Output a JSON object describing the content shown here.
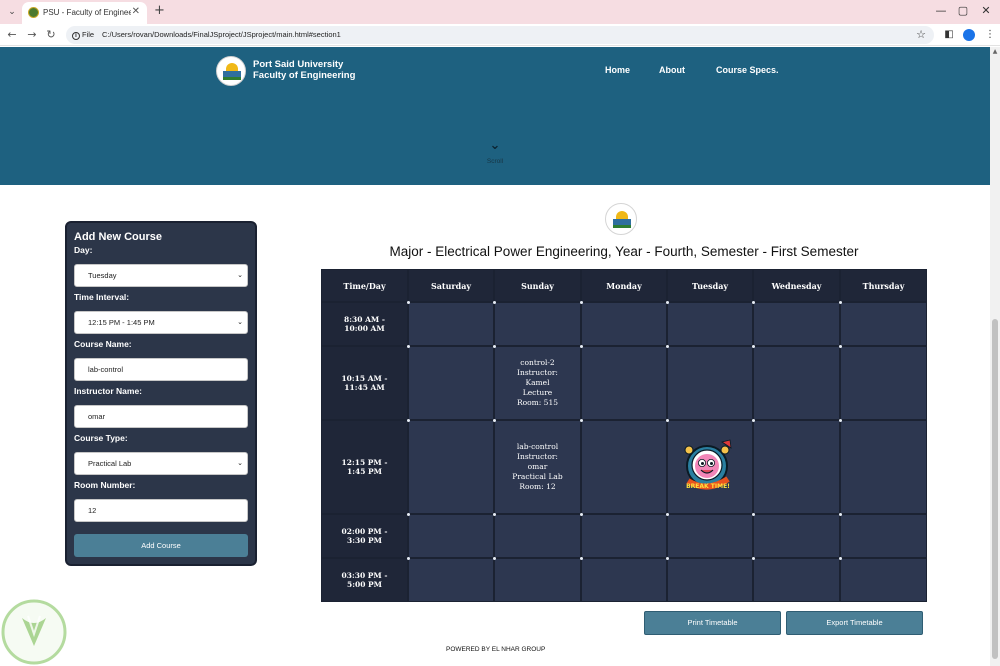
{
  "browser": {
    "tab_title": "PSU - Faculty of Engineering Ti",
    "tab_list_icon": "chevron-down",
    "close_glyph": "✕",
    "newtab_glyph": "+",
    "minimize_glyph": "—",
    "maximize_glyph": "▢",
    "window_close_glyph": "✕",
    "back_glyph": "←",
    "forward_glyph": "→",
    "reload_glyph": "↻",
    "site_info_label": "File",
    "url": "C:/Users/rovan/Downloads/FinalJSproject/JSproject/main.html#section1",
    "star_glyph": "☆",
    "sidepanel_glyph": "◧",
    "profile_glyph": "●",
    "menu_glyph": "⋮"
  },
  "hero": {
    "brand_line1": "Port Said University",
    "brand_line2": "Faculty of Engineering",
    "nav": [
      "Home",
      "About",
      "Course Specs."
    ],
    "scroll_label": "Scroll",
    "scroll_glyph": "⌄"
  },
  "form": {
    "title": "Add New Course",
    "day_label": "Day:",
    "day_value": "Tuesday",
    "time_label": "Time Interval:",
    "time_value": "12:15 PM - 1:45 PM",
    "course_label": "Course Name:",
    "course_value": "lab-control",
    "instructor_label": "Instructor Name:",
    "instructor_value": "omar",
    "type_label": "Course Type:",
    "type_value": "Practical Lab",
    "room_label": "Room Number:",
    "room_value": "12",
    "submit_label": "Add Course",
    "caret_glyph": "⌄"
  },
  "timetable": {
    "heading": "Major - Electrical Power Engineering, Year - Fourth, Semester - First Semester",
    "columns": [
      "Time/Day",
      "Saturday",
      "Sunday",
      "Monday",
      "Tuesday",
      "Wednesday",
      "Thursday"
    ],
    "rows": [
      {
        "time_line1": "8:30 AM -",
        "time_line2": "10:00 AM"
      },
      {
        "time_line1": "10:15 AM -",
        "time_line2": "11:45 AM"
      },
      {
        "time_line1": "12:15 PM -",
        "time_line2": "1:45 PM"
      },
      {
        "time_line1": "02:00 PM -",
        "time_line2": "3:30 PM"
      },
      {
        "time_line1": "03:30 PM -",
        "time_line2": "5:00 PM"
      }
    ],
    "courses": [
      {
        "row": 1,
        "day": "Sunday",
        "name": "control-2",
        "instructor": "Instructor:",
        "instructor_name": "Kamel",
        "type": "Lecture",
        "room": "Room: 515"
      },
      {
        "row": 2,
        "day": "Sunday",
        "name": "lab-control",
        "instructor": "Instructor:",
        "instructor_name": "omar",
        "type": "Practical Lab",
        "room": "Room: 12"
      }
    ],
    "break_sticker_text": "BREAK TIME!",
    "print_label": "Print Timetable",
    "export_label": "Export Timetable"
  },
  "footer": {
    "text": "POWERED BY EL NHAR GROUP"
  },
  "colors": {
    "hero": "#1e6180",
    "panel": "#2c3649",
    "button": "#4b7f96",
    "grid_head": "#1f2638",
    "grid_cell": "#2d3750"
  }
}
